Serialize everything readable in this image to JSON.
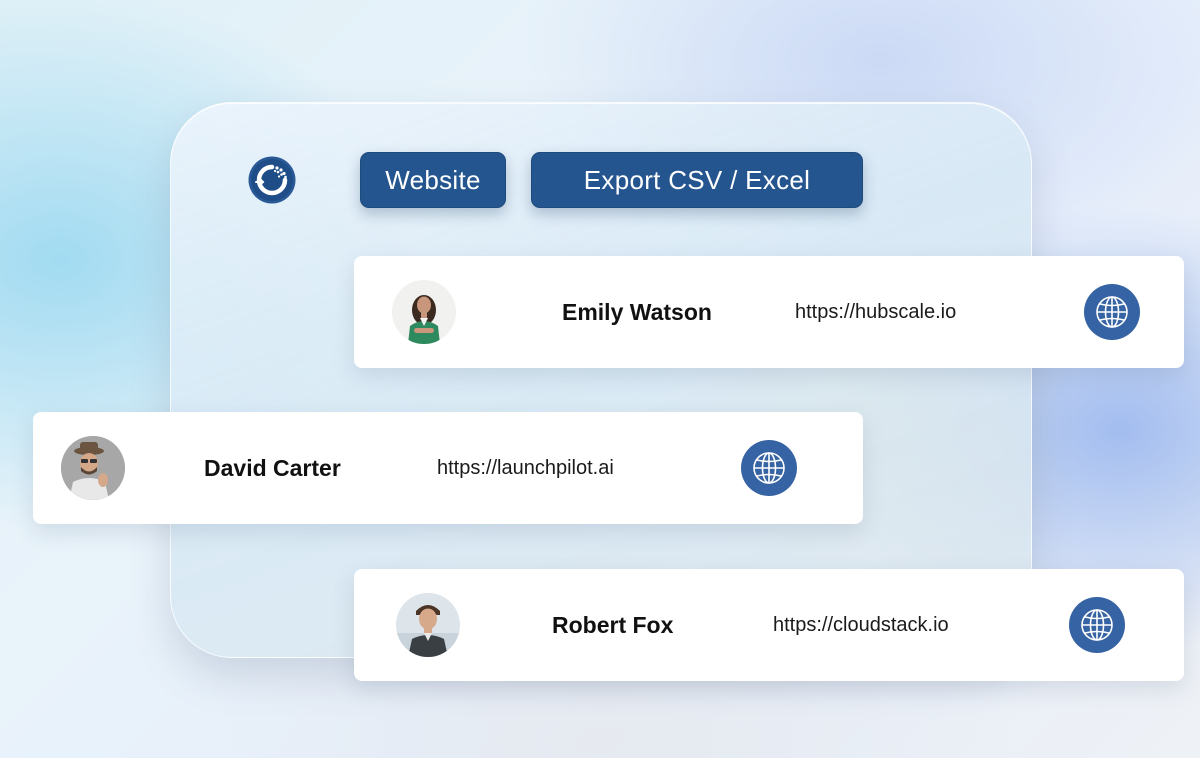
{
  "toolbar": {
    "website_label": "Website",
    "export_label": "Export CSV / Excel"
  },
  "brand": {
    "logo_icon": "magnet-icon",
    "accent_color": "#24558f",
    "globe_color": "#3663a3"
  },
  "contacts": [
    {
      "name": "Emily Watson",
      "url": "https://hubscale.io",
      "icon": "globe-icon"
    },
    {
      "name": "David Carter",
      "url": "https://launchpilot.ai",
      "icon": "globe-icon"
    },
    {
      "name": "Robert Fox",
      "url": "https://cloudstack.io",
      "icon": "globe-icon"
    }
  ]
}
